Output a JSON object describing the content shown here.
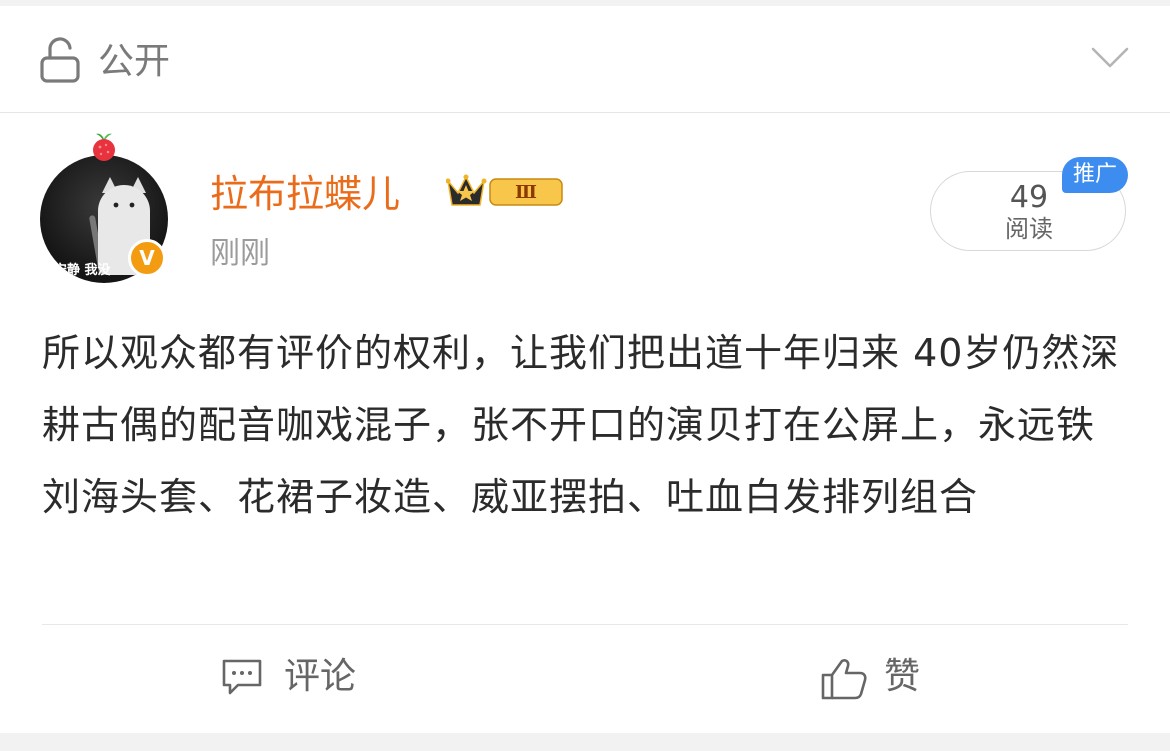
{
  "privacy": {
    "label": "公开"
  },
  "post": {
    "author": "拉布拉蝶儿",
    "member_level": "Ⅲ",
    "avatar_caption": "安静 我没",
    "verified_mark": "V",
    "time": "刚刚",
    "read_count": "49",
    "read_label": "阅读",
    "promo_label": "推广",
    "text": "所以观众都有评价的权利，让我们把出道十年归来 40岁仍然深耕古偶的配音咖戏混子，张不开口的演贝打在公屏上，永远铁刘海头套、花裙子妆造、威亚摆拍、吐血白发排列组合"
  },
  "actions": {
    "comment_label": "评论",
    "like_label": "赞"
  },
  "colors": {
    "username": "#ea6c1b",
    "promo": "#3d8df0",
    "verified": "#f39c12"
  }
}
